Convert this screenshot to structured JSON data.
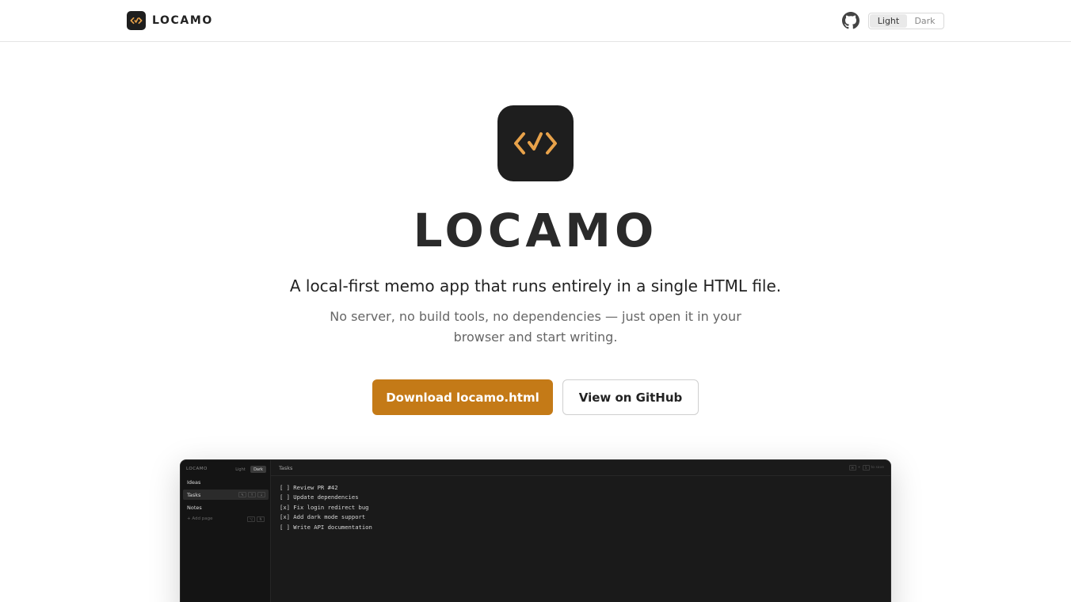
{
  "header": {
    "brand": "LOCAMO",
    "github_icon": "github-icon",
    "theme_options": [
      "Light",
      "Dark"
    ],
    "theme_selected": "Light"
  },
  "hero": {
    "icon": "code-check-icon",
    "title": "LOCAMO",
    "tagline": "A local-first memo app that runs entirely in a single HTML file.",
    "description": "No server, no build tools, no dependencies — just open it in your browser and start writing.",
    "primary_button": "Download locamo.html",
    "secondary_button": "View on GitHub"
  },
  "preview": {
    "brand": "LOCAMO",
    "theme_options": [
      "Light",
      "Dark"
    ],
    "pages": [
      {
        "label": "Ideas"
      },
      {
        "label": "Tasks",
        "active": true
      },
      {
        "label": "Notes"
      }
    ],
    "add_page": "+ Add page",
    "page_title": "Tasks",
    "hint_text": "to save",
    "lines": [
      "[ ] Review PR #42",
      "[ ] Update dependencies",
      "[x] Fix login redirect bug",
      "[x] Add dark mode support",
      "[ ] Write API documentation"
    ]
  },
  "colors": {
    "accent": "#c47a17",
    "logo_bg": "#1e1e1e",
    "logo_glyph": "#e8a24a",
    "preview_bg": "#1a1a1a"
  }
}
